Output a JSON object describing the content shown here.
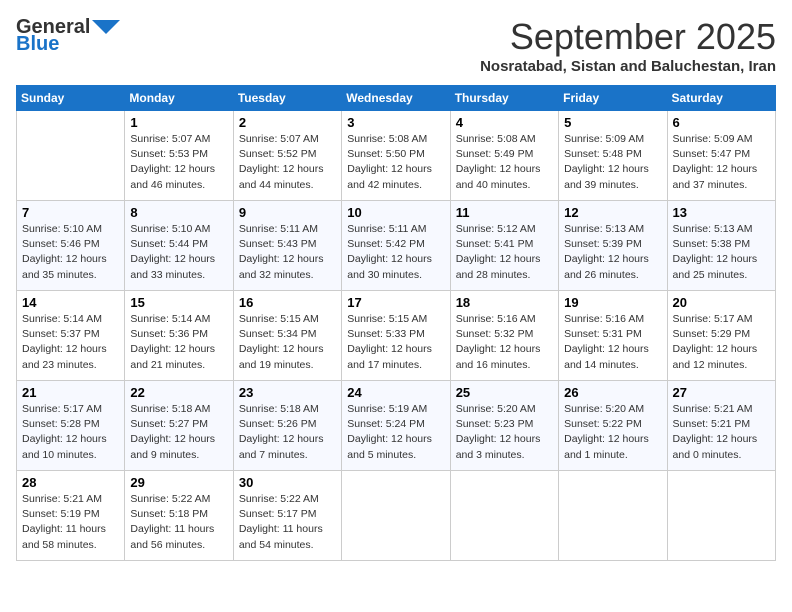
{
  "header": {
    "logo_general": "General",
    "logo_blue": "Blue",
    "month_title": "September 2025",
    "location": "Nosratabad, Sistan and Baluchestan, Iran"
  },
  "days_of_week": [
    "Sunday",
    "Monday",
    "Tuesday",
    "Wednesday",
    "Thursday",
    "Friday",
    "Saturday"
  ],
  "weeks": [
    [
      {
        "day": "",
        "info": ""
      },
      {
        "day": "1",
        "info": "Sunrise: 5:07 AM\nSunset: 5:53 PM\nDaylight: 12 hours\nand 46 minutes."
      },
      {
        "day": "2",
        "info": "Sunrise: 5:07 AM\nSunset: 5:52 PM\nDaylight: 12 hours\nand 44 minutes."
      },
      {
        "day": "3",
        "info": "Sunrise: 5:08 AM\nSunset: 5:50 PM\nDaylight: 12 hours\nand 42 minutes."
      },
      {
        "day": "4",
        "info": "Sunrise: 5:08 AM\nSunset: 5:49 PM\nDaylight: 12 hours\nand 40 minutes."
      },
      {
        "day": "5",
        "info": "Sunrise: 5:09 AM\nSunset: 5:48 PM\nDaylight: 12 hours\nand 39 minutes."
      },
      {
        "day": "6",
        "info": "Sunrise: 5:09 AM\nSunset: 5:47 PM\nDaylight: 12 hours\nand 37 minutes."
      }
    ],
    [
      {
        "day": "7",
        "info": "Sunrise: 5:10 AM\nSunset: 5:46 PM\nDaylight: 12 hours\nand 35 minutes."
      },
      {
        "day": "8",
        "info": "Sunrise: 5:10 AM\nSunset: 5:44 PM\nDaylight: 12 hours\nand 33 minutes."
      },
      {
        "day": "9",
        "info": "Sunrise: 5:11 AM\nSunset: 5:43 PM\nDaylight: 12 hours\nand 32 minutes."
      },
      {
        "day": "10",
        "info": "Sunrise: 5:11 AM\nSunset: 5:42 PM\nDaylight: 12 hours\nand 30 minutes."
      },
      {
        "day": "11",
        "info": "Sunrise: 5:12 AM\nSunset: 5:41 PM\nDaylight: 12 hours\nand 28 minutes."
      },
      {
        "day": "12",
        "info": "Sunrise: 5:13 AM\nSunset: 5:39 PM\nDaylight: 12 hours\nand 26 minutes."
      },
      {
        "day": "13",
        "info": "Sunrise: 5:13 AM\nSunset: 5:38 PM\nDaylight: 12 hours\nand 25 minutes."
      }
    ],
    [
      {
        "day": "14",
        "info": "Sunrise: 5:14 AM\nSunset: 5:37 PM\nDaylight: 12 hours\nand 23 minutes."
      },
      {
        "day": "15",
        "info": "Sunrise: 5:14 AM\nSunset: 5:36 PM\nDaylight: 12 hours\nand 21 minutes."
      },
      {
        "day": "16",
        "info": "Sunrise: 5:15 AM\nSunset: 5:34 PM\nDaylight: 12 hours\nand 19 minutes."
      },
      {
        "day": "17",
        "info": "Sunrise: 5:15 AM\nSunset: 5:33 PM\nDaylight: 12 hours\nand 17 minutes."
      },
      {
        "day": "18",
        "info": "Sunrise: 5:16 AM\nSunset: 5:32 PM\nDaylight: 12 hours\nand 16 minutes."
      },
      {
        "day": "19",
        "info": "Sunrise: 5:16 AM\nSunset: 5:31 PM\nDaylight: 12 hours\nand 14 minutes."
      },
      {
        "day": "20",
        "info": "Sunrise: 5:17 AM\nSunset: 5:29 PM\nDaylight: 12 hours\nand 12 minutes."
      }
    ],
    [
      {
        "day": "21",
        "info": "Sunrise: 5:17 AM\nSunset: 5:28 PM\nDaylight: 12 hours\nand 10 minutes."
      },
      {
        "day": "22",
        "info": "Sunrise: 5:18 AM\nSunset: 5:27 PM\nDaylight: 12 hours\nand 9 minutes."
      },
      {
        "day": "23",
        "info": "Sunrise: 5:18 AM\nSunset: 5:26 PM\nDaylight: 12 hours\nand 7 minutes."
      },
      {
        "day": "24",
        "info": "Sunrise: 5:19 AM\nSunset: 5:24 PM\nDaylight: 12 hours\nand 5 minutes."
      },
      {
        "day": "25",
        "info": "Sunrise: 5:20 AM\nSunset: 5:23 PM\nDaylight: 12 hours\nand 3 minutes."
      },
      {
        "day": "26",
        "info": "Sunrise: 5:20 AM\nSunset: 5:22 PM\nDaylight: 12 hours\nand 1 minute."
      },
      {
        "day": "27",
        "info": "Sunrise: 5:21 AM\nSunset: 5:21 PM\nDaylight: 12 hours\nand 0 minutes."
      }
    ],
    [
      {
        "day": "28",
        "info": "Sunrise: 5:21 AM\nSunset: 5:19 PM\nDaylight: 11 hours\nand 58 minutes."
      },
      {
        "day": "29",
        "info": "Sunrise: 5:22 AM\nSunset: 5:18 PM\nDaylight: 11 hours\nand 56 minutes."
      },
      {
        "day": "30",
        "info": "Sunrise: 5:22 AM\nSunset: 5:17 PM\nDaylight: 11 hours\nand 54 minutes."
      },
      {
        "day": "",
        "info": ""
      },
      {
        "day": "",
        "info": ""
      },
      {
        "day": "",
        "info": ""
      },
      {
        "day": "",
        "info": ""
      }
    ]
  ]
}
